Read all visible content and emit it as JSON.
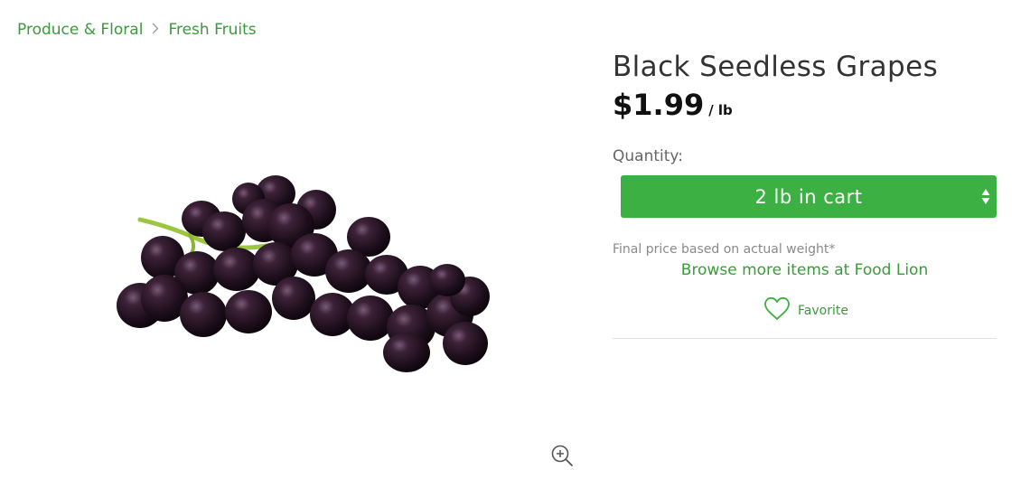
{
  "breadcrumb": {
    "items": [
      {
        "label": "Produce & Floral"
      },
      {
        "label": "Fresh Fruits"
      }
    ]
  },
  "product": {
    "title": "Black Seedless Grapes",
    "price": "$1.99",
    "unit": "/ lb",
    "image_icon": "grapes-image"
  },
  "quantity": {
    "label": "Quantity:",
    "value": "2 lb in cart"
  },
  "notes": {
    "price_note": "Final price based on actual weight*",
    "browse_link": "Browse more items at Food Lion"
  },
  "favorite": {
    "label": "Favorite",
    "icon": "heart-icon"
  },
  "colors": {
    "accent_green": "#3cb043",
    "link_green": "#3a9b3a"
  }
}
